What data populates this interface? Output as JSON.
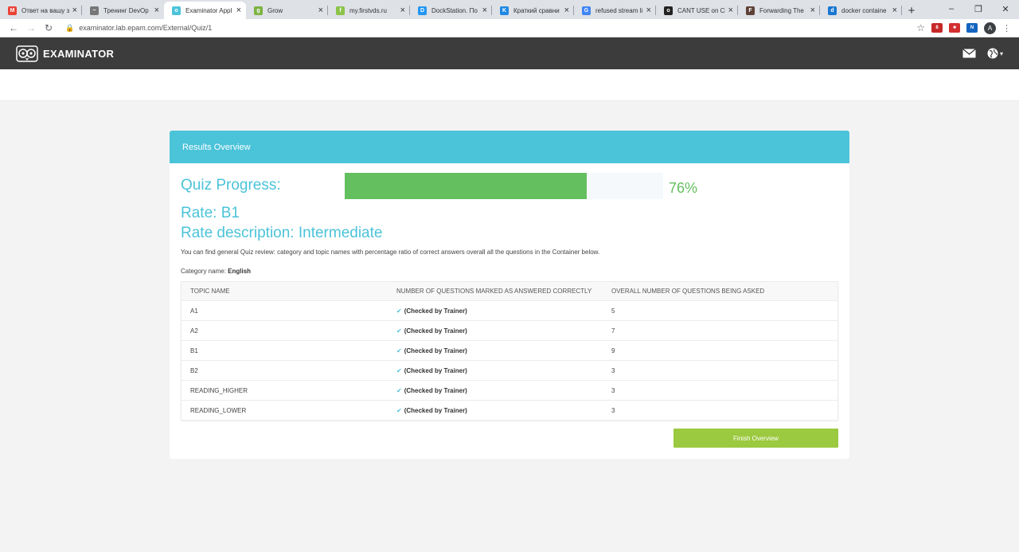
{
  "browser": {
    "tabs": [
      {
        "title": "Ответ на вашу з",
        "fav_color": "#ea4335",
        "fav_glyph": "M",
        "active": false
      },
      {
        "title": "Тренинг DevOp",
        "fav_color": "#777777",
        "fav_glyph": "~",
        "active": false
      },
      {
        "title": "Examinator Appl",
        "fav_color": "#4bc3d9",
        "fav_glyph": "o",
        "active": true
      },
      {
        "title": "Grow",
        "fav_color": "#7cb342",
        "fav_glyph": "g",
        "active": false
      },
      {
        "title": "my.firstvds.ru",
        "fav_color": "#8bc34a",
        "fav_glyph": "f",
        "active": false
      },
      {
        "title": "DockStation. По",
        "fav_color": "#2196f3",
        "fav_glyph": "D",
        "active": false
      },
      {
        "title": "Краткий сравни",
        "fav_color": "#1e88e5",
        "fav_glyph": "K",
        "active": false
      },
      {
        "title": "refused stream li",
        "fav_color": "#4285f4",
        "fav_glyph": "G",
        "active": false
      },
      {
        "title": "CANT USE on Cl",
        "fav_color": "#222222",
        "fav_glyph": "o",
        "active": false
      },
      {
        "title": "Forwarding The",
        "fav_color": "#5d4037",
        "fav_glyph": "F",
        "active": false
      },
      {
        "title": "docker containe",
        "fav_color": "#1976d2",
        "fav_glyph": "d",
        "active": false
      }
    ],
    "url": "examinator.lab.epam.com/External/Quiz/1",
    "profile_initial": "A"
  },
  "app": {
    "brand": "EXAMINATOR"
  },
  "results": {
    "header": "Results Overview",
    "progress_label": "Quiz Progress:",
    "progress_value": 0.76,
    "progress_text": "76%",
    "rate": "Rate: B1",
    "rate_description": "Rate description: Intermediate",
    "info": "You can find general Quiz review: category and topic names with percentage ratio of correct answers overall all the questions in the Container below.",
    "category_prefix": "Category name:",
    "category_name": "English",
    "columns": [
      "TOPIC NAME",
      "NUMBER OF QUESTIONS MARKED AS ANSWERED CORRECTLY",
      "OVERALL NUMBER OF QUESTIONS BEING ASKED"
    ],
    "rows": [
      {
        "topic": "A1",
        "correct": "(Checked by Trainer)",
        "total": "5"
      },
      {
        "topic": "A2",
        "correct": "(Checked by Trainer)",
        "total": "7"
      },
      {
        "topic": "B1",
        "correct": "(Checked by Trainer)",
        "total": "9"
      },
      {
        "topic": "B2",
        "correct": "(Checked by Trainer)",
        "total": "3"
      },
      {
        "topic": "READING_HIGHER",
        "correct": "(Checked by Trainer)",
        "total": "3"
      },
      {
        "topic": "READING_LOWER",
        "correct": "(Checked by Trainer)",
        "total": "3"
      }
    ],
    "finish_label": "Finish Overview"
  },
  "colors": {
    "accent": "#4bc3d9",
    "progress": "#64bf5f",
    "finish": "#9bc93f",
    "appbar": "#3c3c3c"
  }
}
